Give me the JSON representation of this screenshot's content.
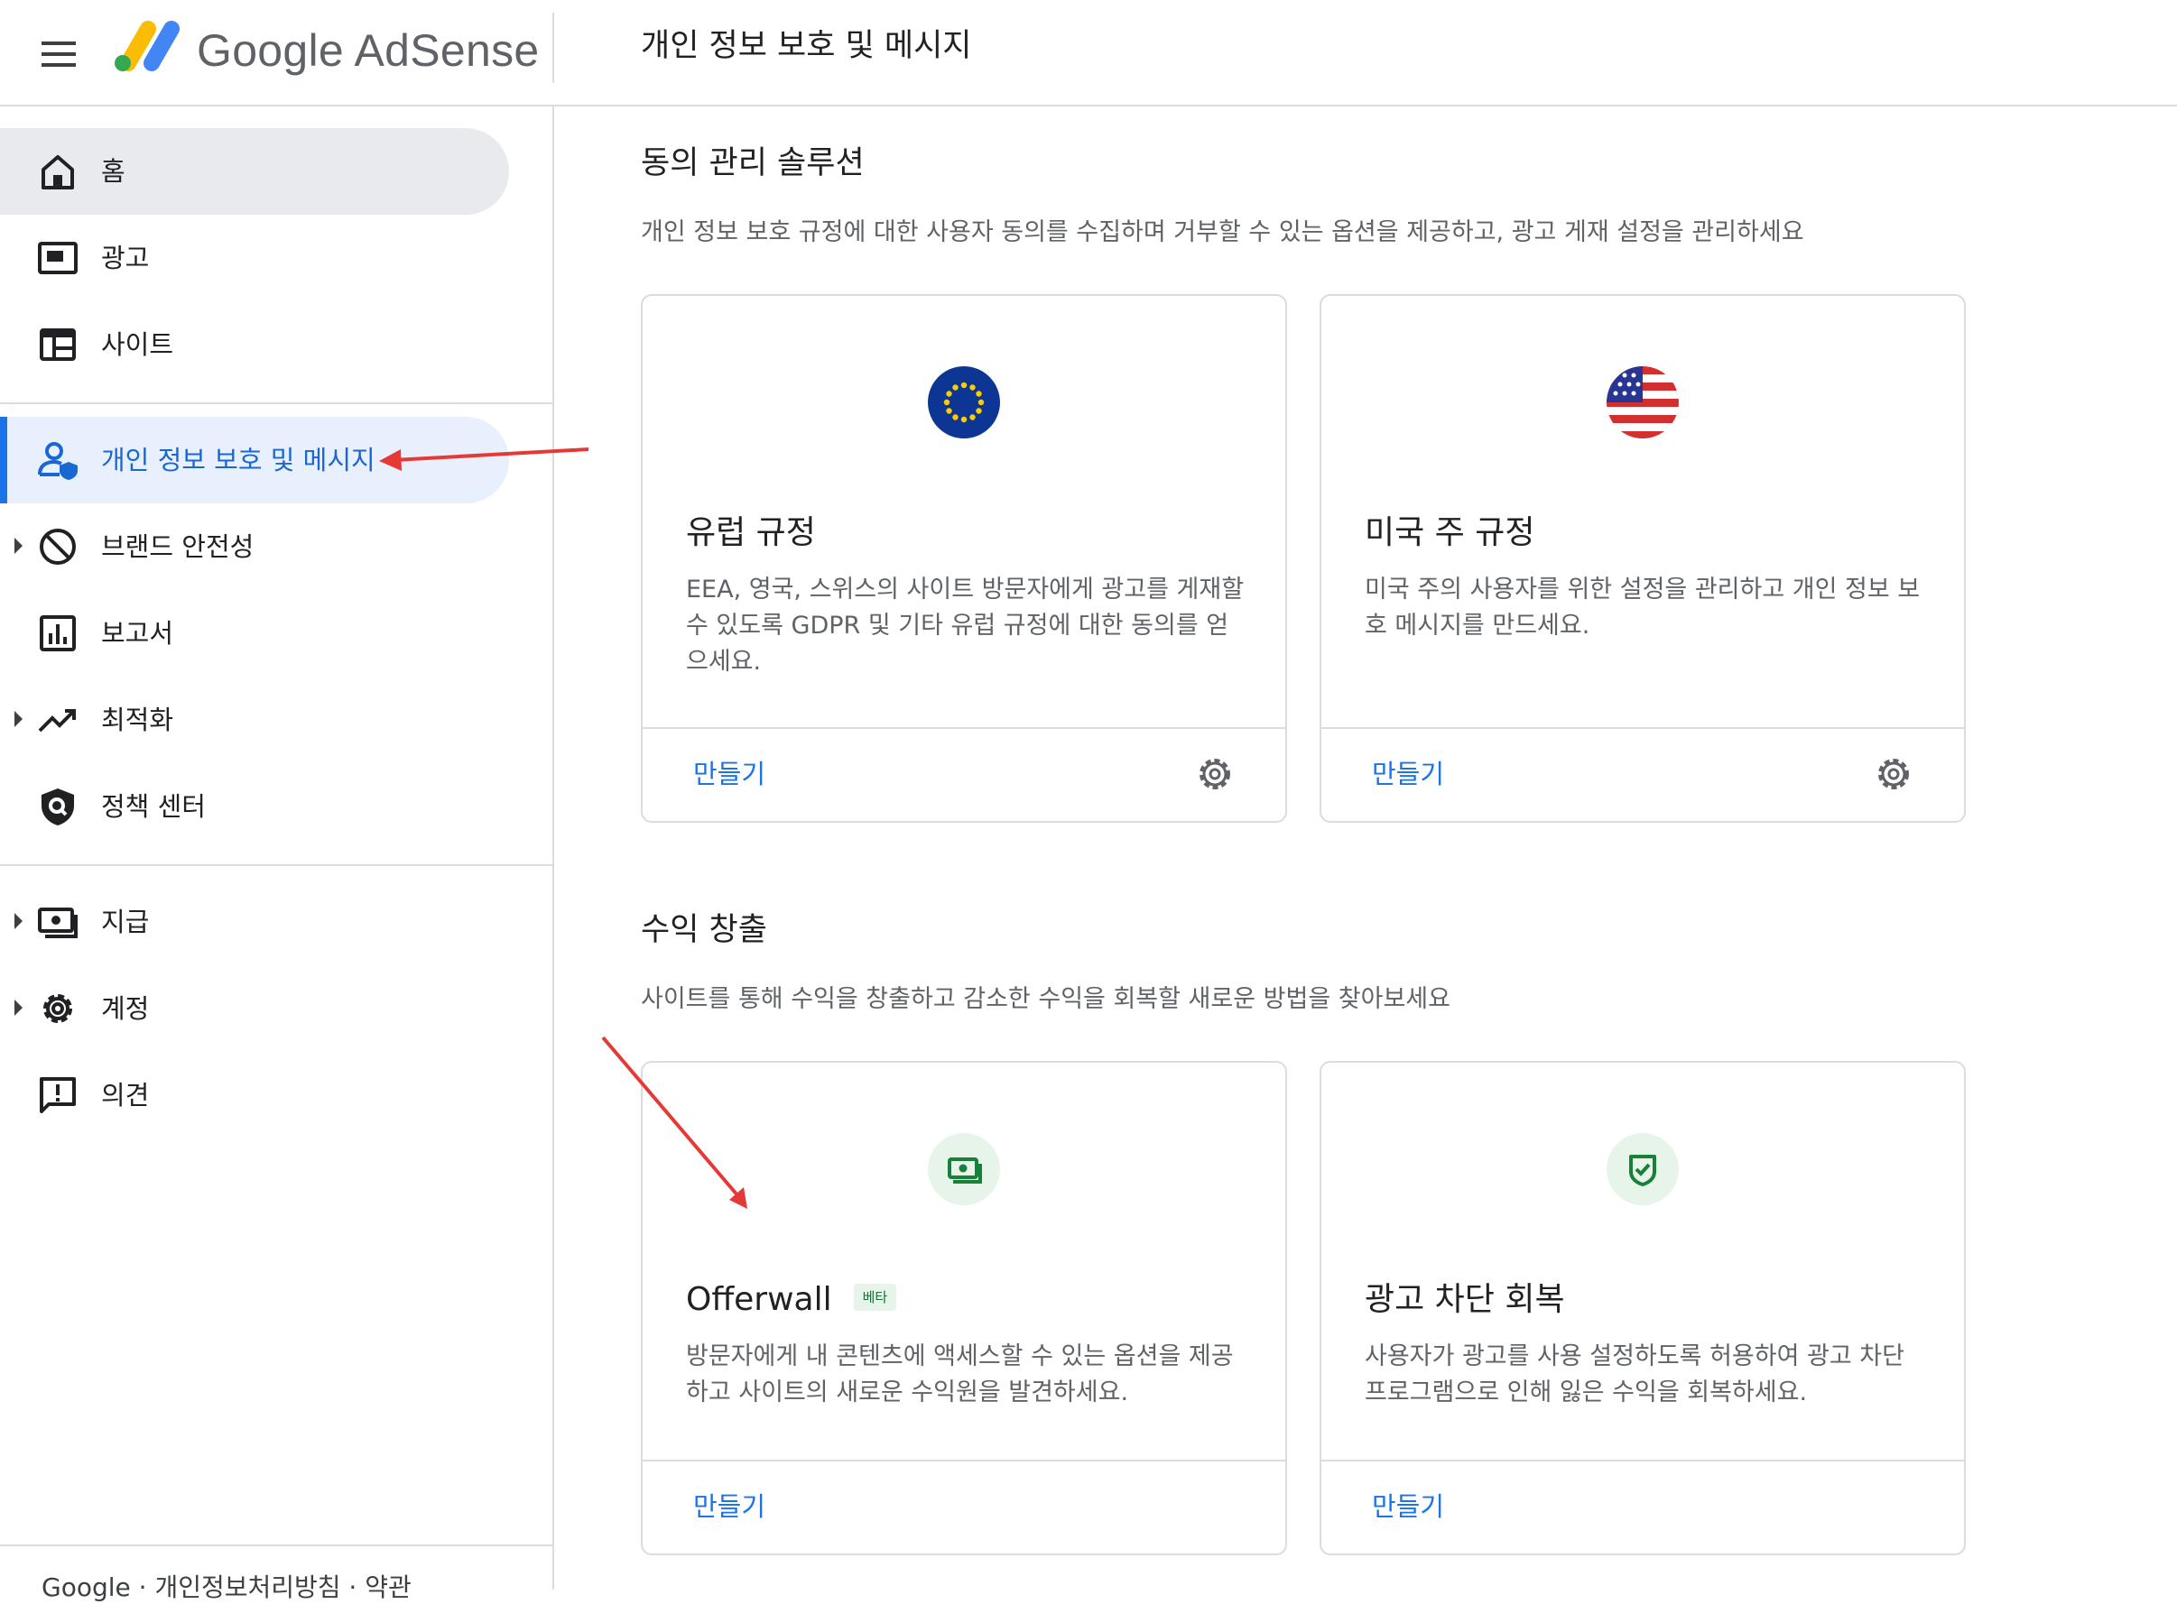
{
  "header": {
    "brand": "Google AdSense",
    "page_title": "개인 정보 보호 및 메시지"
  },
  "sidebar": {
    "items": [
      {
        "label": "홈",
        "icon": "home-icon"
      },
      {
        "label": "광고",
        "icon": "ads-icon"
      },
      {
        "label": "사이트",
        "icon": "sites-icon"
      },
      {
        "label": "개인 정보 보호 및 메시지",
        "icon": "privacy-messaging-icon"
      },
      {
        "label": "브랜드 안전성",
        "icon": "block-icon"
      },
      {
        "label": "보고서",
        "icon": "reports-icon"
      },
      {
        "label": "최적화",
        "icon": "trending-up-icon"
      },
      {
        "label": "정책 센터",
        "icon": "policy-shield-icon"
      },
      {
        "label": "지급",
        "icon": "payments-icon"
      },
      {
        "label": "계정",
        "icon": "gear-icon"
      },
      {
        "label": "의견",
        "icon": "feedback-icon"
      }
    ],
    "footer": "Google · 개인정보처리방침 · 약관"
  },
  "consent": {
    "title": "동의 관리 솔루션",
    "desc": "개인 정보 보호 규정에 대한 사용자 동의를 수집하며 거부할 수 있는 옵션을 제공하고, 광고 게재 설정을 관리하세요",
    "cards": [
      {
        "title": "유럽 규정",
        "desc": "EEA, 영국, 스위스의 사이트 방문자에게 광고를 게재할 수 있도록 GDPR 및 기타 유럽 규정에 대한 동의를 얻으세요.",
        "action": "만들기"
      },
      {
        "title": "미국 주 규정",
        "desc": "미국 주의 사용자를 위한 설정을 관리하고 개인 정보 보호 메시지를 만드세요.",
        "action": "만들기"
      }
    ]
  },
  "monetization": {
    "title": "수익 창출",
    "desc": "사이트를 통해 수익을 창출하고 감소한 수익을 회복할 새로운 방법을 찾아보세요",
    "cards": [
      {
        "title": "Offerwall",
        "badge": "베타",
        "desc": "방문자에게 내 콘텐츠에 액세스할 수 있는 옵션을 제공하고 사이트의 새로운 수익원을 발견하세요.",
        "action": "만들기"
      },
      {
        "title": "광고 차단 회복",
        "desc": "사용자가 광고를 사용 설정하도록 허용하여 광고 차단 프로그램으로 인해 잃은 수익을 회복하세요.",
        "action": "만들기"
      }
    ]
  },
  "colors": {
    "accent": "#1a73e8",
    "active_bg": "#e8f0fe",
    "home_bg": "#e8eaed",
    "annotation_arrow": "#e53935",
    "eu_blue": "#0d3694",
    "eu_star": "#ffcc00",
    "green_bg": "#e6f4ea",
    "green": "#188038"
  }
}
